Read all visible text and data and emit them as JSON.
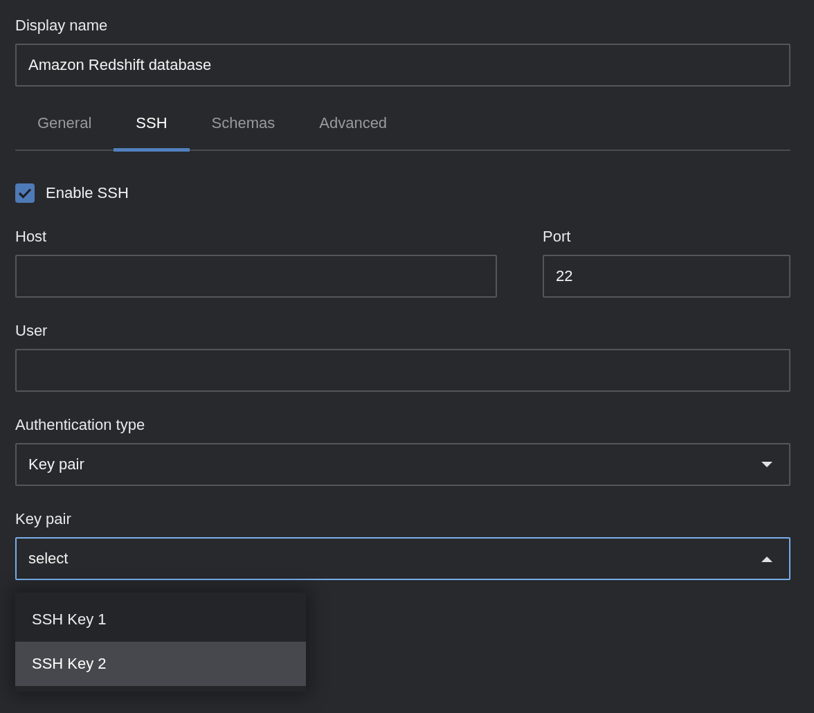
{
  "display_name": {
    "label": "Display name",
    "value": "Amazon Redshift database"
  },
  "tabs": [
    {
      "label": "General",
      "selected": false
    },
    {
      "label": "SSH",
      "selected": true
    },
    {
      "label": "Schemas",
      "selected": false
    },
    {
      "label": "Advanced",
      "selected": false
    }
  ],
  "enable_ssh": {
    "label": "Enable SSH",
    "checked": true
  },
  "host": {
    "label": "Host"
  },
  "port": {
    "label": "Port",
    "value": "22"
  },
  "user": {
    "label": "User"
  },
  "authentication_type": {
    "label": "Authentication type",
    "value": "Key pair",
    "expanded": false,
    "focused": false
  },
  "key_pair": {
    "label": "Key pair",
    "value": "select",
    "expanded": true,
    "focused": true,
    "options": [
      {
        "label": "SSH Key 1",
        "highlighted": false
      },
      {
        "label": "SSH Key 2",
        "highlighted": true
      }
    ]
  }
}
